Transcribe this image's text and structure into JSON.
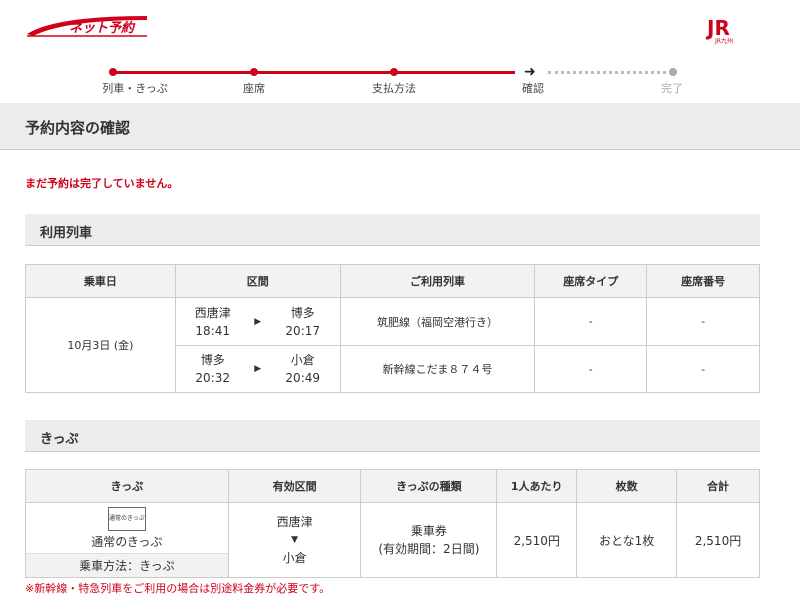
{
  "header": {
    "logo_text": "ネット予約",
    "brand_text": "JR九州"
  },
  "steps": [
    {
      "label": "列車・きっぷ",
      "state": "done"
    },
    {
      "label": "座席",
      "state": "done"
    },
    {
      "label": "支払方法",
      "state": "done"
    },
    {
      "label": "確認",
      "state": "current"
    },
    {
      "label": "完了",
      "state": "pending"
    }
  ],
  "page_title": "予約内容の確認",
  "notice": "まだ予約は完了していません。",
  "train_section": {
    "title": "利用列車",
    "headers": [
      "乗車日",
      "区間",
      "ご利用列車",
      "座席タイプ",
      "座席番号"
    ],
    "date": "10月3日 (金)",
    "rows": [
      {
        "from": "西唐津",
        "dep": "18:41",
        "to": "博多",
        "arr": "20:17",
        "train": "筑肥線（福岡空港行き）",
        "seat_type": "-",
        "seat_no": "-"
      },
      {
        "from": "博多",
        "dep": "20:32",
        "to": "小倉",
        "arr": "20:49",
        "train": "新幹線こだま８７４号",
        "seat_type": "-",
        "seat_no": "-"
      }
    ]
  },
  "ticket_section": {
    "title": "きっぷ",
    "headers": [
      "きっぷ",
      "有効区間",
      "きっぷの種類",
      "1人あたり",
      "枚数",
      "合計"
    ],
    "ticket_image_text": "通常のきっぷ",
    "ticket_name": "通常のきっぷ",
    "boarding_method": "乗車方法：きっぷ",
    "valid_from": "西唐津",
    "valid_to": "小倉",
    "kind_line1": "乗車券",
    "kind_line2": "(有効期間：2日間)",
    "unit_price": "2,510円",
    "count": "おとな1枚",
    "total": "2,510円"
  },
  "footnote": "※新幹線・特急列車をご利用の場合は別途料金券が必要です。",
  "colors": {
    "accent": "#d0021b",
    "header_bg": "#ececec"
  }
}
